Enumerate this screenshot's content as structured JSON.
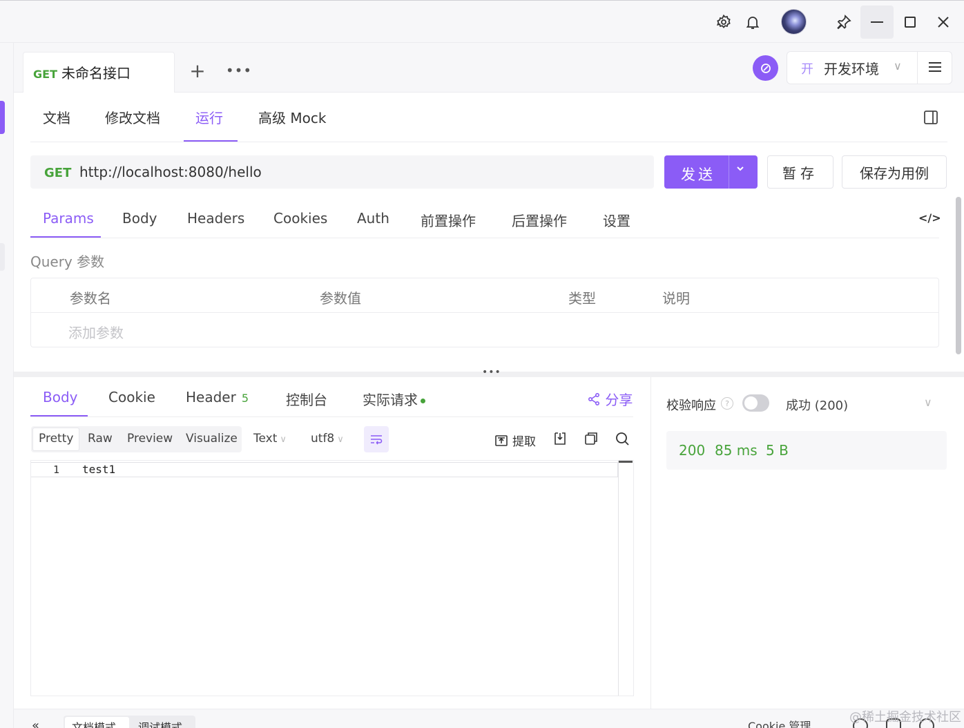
{
  "window": {
    "icons": [
      "settings-icon",
      "bell-icon",
      "avatar",
      "pin-icon",
      "minimize-icon",
      "maximize-icon",
      "close-icon"
    ]
  },
  "tab": {
    "method": "GET",
    "title": "未命名接口"
  },
  "env": {
    "tag": "开",
    "name": "开发环境"
  },
  "doc_tabs": [
    {
      "label": "文档"
    },
    {
      "label": "修改文档"
    },
    {
      "label": "运行",
      "active": true
    },
    {
      "label": "高级 Mock"
    }
  ],
  "request": {
    "method": "GET",
    "url": "http://localhost:8080/hello",
    "send_label": "发送",
    "save_label": "暂存",
    "save_case_label": "保存为用例"
  },
  "req_tabs": [
    {
      "label": "Params",
      "active": true
    },
    {
      "label": "Body"
    },
    {
      "label": "Headers"
    },
    {
      "label": "Cookies"
    },
    {
      "label": "Auth"
    },
    {
      "label": "前置操作"
    },
    {
      "label": "后置操作"
    },
    {
      "label": "设置"
    }
  ],
  "query": {
    "label": "Query 参数",
    "columns": [
      "参数名",
      "参数值",
      "类型",
      "说明"
    ],
    "add_placeholder": "添加参数"
  },
  "response": {
    "tabs": [
      {
        "label": "Body",
        "active": true
      },
      {
        "label": "Cookie"
      },
      {
        "label": "Header",
        "count": "5"
      },
      {
        "label": "控制台"
      },
      {
        "label": "实际请求"
      }
    ],
    "share_label": "分享",
    "view_modes": [
      "Pretty",
      "Raw",
      "Preview",
      "Visualize"
    ],
    "format": "Text",
    "encoding": "utf8",
    "extract_label": "提取",
    "body_lines": [
      {
        "num": "1",
        "text": "test1"
      }
    ],
    "validate_label": "校验响应",
    "validate_on": false,
    "success_label": "成功 (200)",
    "status_code": "200",
    "time": "85 ms",
    "size": "5 B"
  },
  "bottom": {
    "modes": [
      "文档模式",
      "调试模式"
    ],
    "cookie_label": "Cookie 管理",
    "watermark": "@稀土掘金技术社区"
  },
  "colors": {
    "accent": "#8b5cf6",
    "green": "#47a33a"
  }
}
